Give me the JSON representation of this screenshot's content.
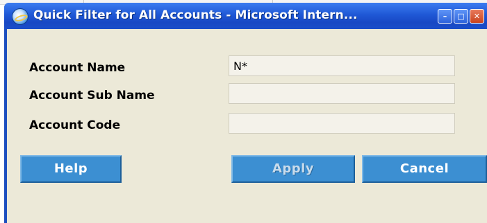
{
  "window": {
    "title": "Quick Filter for All Accounts - Microsoft Intern...",
    "minimize_icon": "minimize-icon",
    "maximize_icon": "maximize-icon",
    "close_icon": "close-icon",
    "app_icon": "internet-explorer-icon"
  },
  "form": {
    "fields": [
      {
        "label": "Account Name",
        "value": "N*"
      },
      {
        "label": "Account Sub Name",
        "value": ""
      },
      {
        "label": "Account Code",
        "value": ""
      }
    ]
  },
  "buttons": {
    "help": "Help",
    "apply": "Apply",
    "cancel": "Cancel"
  },
  "colors": {
    "titlebar": "#1f58d6",
    "client_bg": "#ece9d8",
    "button_bg": "#3c8fd2"
  }
}
